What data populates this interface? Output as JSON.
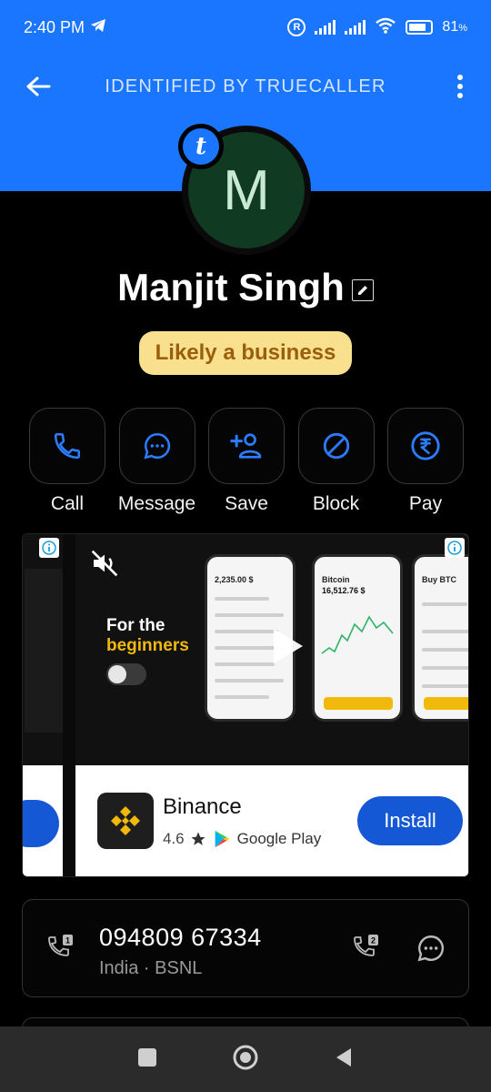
{
  "status_bar": {
    "time": "2:40 PM",
    "battery": "81",
    "battery_unit": "%"
  },
  "header": {
    "title": "IDENTIFIED BY TRUECALLER"
  },
  "contact": {
    "avatar_letter": "M",
    "badge_letter": "t",
    "name": "Manjit Singh",
    "tag": "Likely a business"
  },
  "actions": [
    {
      "label": "Call"
    },
    {
      "label": "Message"
    },
    {
      "label": "Save"
    },
    {
      "label": "Block"
    },
    {
      "label": "Pay"
    }
  ],
  "ad": {
    "headline_1": "For the",
    "headline_2": "beginners",
    "app_name": "Binance",
    "rating": "4.6",
    "store": "Google Play",
    "install_label": "Install",
    "phone_1_title": "2,235.00 $",
    "phone_2_title": "Bitcoin",
    "phone_2_value": "16,512.76 $",
    "phone_3_title": "Buy BTC"
  },
  "number": {
    "value": "094809 67334",
    "sub": "India · BSNL"
  },
  "colors": {
    "accent": "#1a75ff",
    "tag_bg": "#f8e08e",
    "tag_text": "#9a5f0c",
    "icon_blue": "#2b7cff",
    "avatar_bg": "#103a22"
  }
}
